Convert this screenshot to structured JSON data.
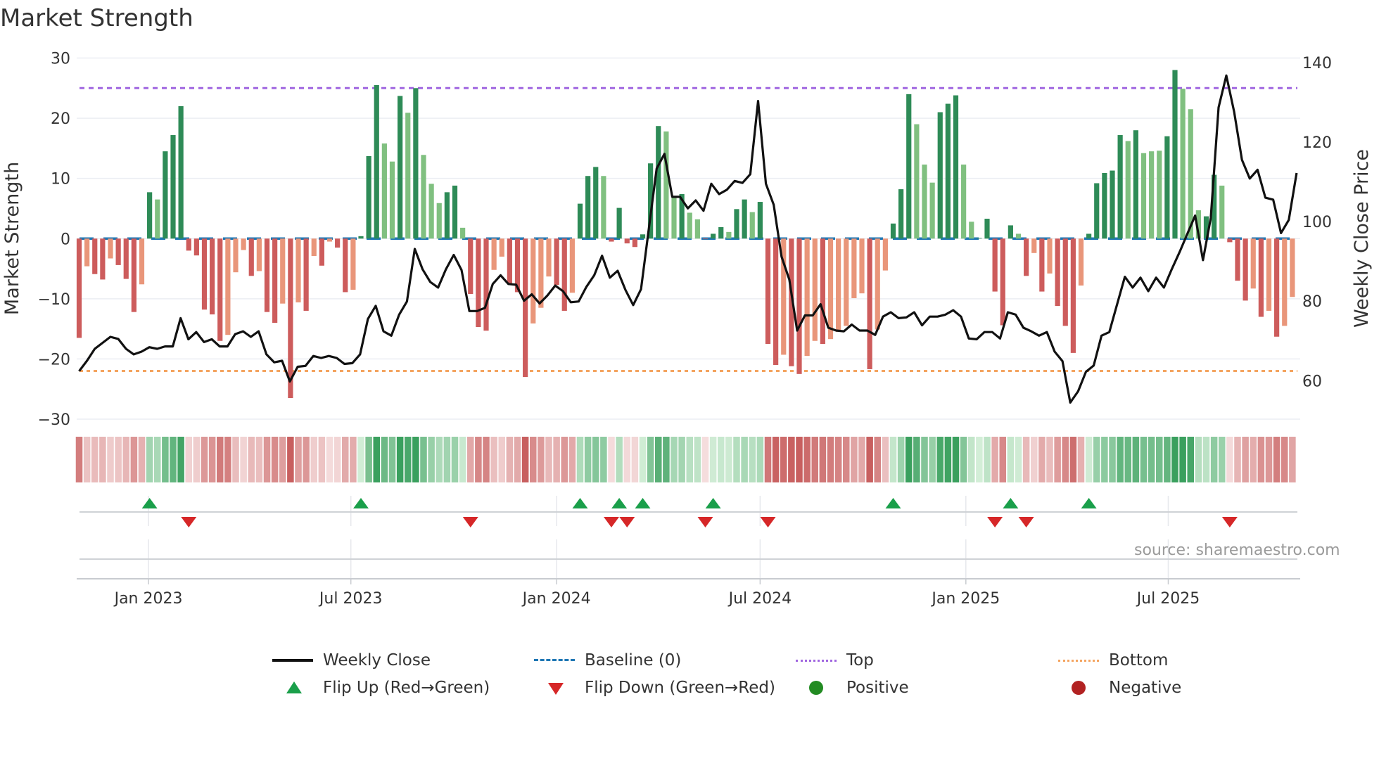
{
  "title": "Market Strength",
  "source": "source: sharemaestro.com",
  "colors": {
    "green_strong": "#2e8b57",
    "green_weak": "#80c080",
    "red_strong": "#cd5c5c",
    "red_weak": "#e9967a",
    "line": "#111111",
    "baseline": "#1f77b4",
    "top": "#a066e0",
    "bottom": "#f4a460",
    "flip_up": "#1a9f4a",
    "flip_down": "#d62728"
  },
  "legend": {
    "weekly_close": "Weekly Close",
    "baseline": "Baseline (0)",
    "top": "Top",
    "bottom": "Bottom",
    "flip_up": "Flip Up (Red→Green)",
    "flip_down": "Flip Down (Green→Red)",
    "positive": "Positive",
    "negative": "Negative"
  },
  "chart_data": {
    "type": "bar+line",
    "title": "Market Strength",
    "ylabel": "Market Strength",
    "y2label": "Weekly Close Price",
    "ylim": [
      -30,
      30
    ],
    "yticks": [
      30,
      20,
      10,
      0,
      -10,
      -20,
      -30
    ],
    "ytick_labels": [
      "30",
      "20",
      "10",
      "0",
      "−10",
      "−20",
      "−30"
    ],
    "y2lim": [
      60,
      140
    ],
    "y2ticks": [
      140,
      120,
      100,
      80,
      60
    ],
    "y2tick_labels": [
      "140",
      "120",
      "100",
      "80",
      "60"
    ],
    "start_week": "2022-10-31",
    "xticks": [
      {
        "date": "2023-01-01",
        "label": "Jan 2023"
      },
      {
        "date": "2023-07-01",
        "label": "Jul 2023"
      },
      {
        "date": "2024-01-01",
        "label": "Jan 2024"
      },
      {
        "date": "2024-07-01",
        "label": "Jul 2024"
      },
      {
        "date": "2025-01-01",
        "label": "Jan 2025"
      },
      {
        "date": "2025-07-01",
        "label": "Jul 2025"
      }
    ],
    "top_level": 25,
    "bottom_level": -22,
    "baseline": 0,
    "strength": [
      -16.5,
      -4.6,
      -5.9,
      -6.8,
      -3.3,
      -4.4,
      -6.7,
      -12.2,
      -7.6,
      7.7,
      6.5,
      14.5,
      17.2,
      22,
      -2,
      -2.8,
      -11.8,
      -12.6,
      -17,
      -16,
      -5.6,
      -1.9,
      -6.2,
      -5.4,
      -12.2,
      -14,
      -10.8,
      -26.5,
      -10.6,
      -12,
      -2.9,
      -4.5,
      -0.5,
      -1.5,
      -8.9,
      -8.5,
      0.4,
      13.7,
      25.5,
      15.8,
      12.8,
      23.7,
      20.9,
      25,
      13.9,
      9.1,
      5.9,
      7.7,
      8.8,
      1.8,
      -9.2,
      -14.7,
      -15.3,
      -5.2,
      -3,
      -7.5,
      -8.9,
      -23,
      -14.1,
      -11.5,
      -6.3,
      -7.7,
      -12,
      -9,
      5.8,
      10.4,
      11.9,
      10.4,
      -0.5,
      5.1,
      -0.8,
      -1.4,
      0.7,
      12.5,
      18.7,
      17.8,
      6.9,
      7.4,
      4.3,
      3.2,
      -0.1,
      0.8,
      1.9,
      1.1,
      4.9,
      6.5,
      4.4,
      6.1,
      -17.5,
      -21,
      -19.3,
      -21.2,
      -22.5,
      -19.5,
      -17,
      -17.5,
      -16.7,
      -15.5,
      -14.5,
      -9.9,
      -9.1,
      -21.7,
      -15.1,
      -5.3,
      2.5,
      8.2,
      24,
      19,
      12.3,
      9.3,
      21,
      22.4,
      23.8,
      12.3,
      2.8,
      0.1,
      3.3,
      -8.8,
      -14.4,
      2.2,
      0.8,
      -6.2,
      -2.4,
      -8.8,
      -5.8,
      -11.2,
      -14.5,
      -19,
      -7.8,
      0.8,
      9.2,
      10.9,
      11.3,
      17.2,
      16.2,
      18,
      14.2,
      14.5,
      14.6,
      17,
      28,
      24.9,
      21.5,
      4.7,
      3.7,
      10.6,
      8.8,
      -0.6,
      -7,
      -10.3,
      -8.3,
      -13,
      -12,
      -16.3,
      -14.5,
      -9.7
    ],
    "strong": [
      1,
      0,
      1,
      1,
      0,
      1,
      1,
      1,
      0,
      1,
      0,
      1,
      1,
      1,
      1,
      1,
      1,
      1,
      1,
      0,
      0,
      0,
      1,
      0,
      1,
      1,
      0,
      1,
      0,
      1,
      0,
      1,
      0,
      1,
      1,
      0,
      1,
      1,
      1,
      0,
      0,
      1,
      0,
      1,
      0,
      0,
      0,
      1,
      1,
      0,
      1,
      1,
      1,
      0,
      0,
      1,
      1,
      1,
      0,
      0,
      0,
      1,
      1,
      0,
      1,
      1,
      1,
      0,
      1,
      1,
      1,
      1,
      1,
      1,
      1,
      0,
      0,
      1,
      0,
      0,
      1,
      1,
      1,
      0,
      1,
      1,
      0,
      1,
      1,
      1,
      0,
      1,
      1,
      0,
      0,
      1,
      0,
      0,
      0,
      0,
      0,
      1,
      0,
      0,
      1,
      1,
      1,
      0,
      0,
      0,
      1,
      1,
      1,
      0,
      0,
      1,
      1,
      1,
      1,
      1,
      0,
      1,
      0,
      1,
      0,
      1,
      1,
      1,
      0,
      1,
      1,
      1,
      1,
      1,
      0,
      1,
      0,
      0,
      0,
      1,
      1,
      0,
      0,
      0,
      1,
      1,
      0,
      1,
      1,
      1,
      0,
      1,
      0,
      1,
      0,
      0
    ],
    "weekly_close": [
      62.4,
      65,
      68,
      69.5,
      71,
      70.5,
      68,
      66.6,
      67.3,
      68.4,
      68,
      68.6,
      68.6,
      75.7,
      70.4,
      72.2,
      69.7,
      70.4,
      68.6,
      68.6,
      71.7,
      72.4,
      71,
      72.4,
      66.6,
      64.6,
      65,
      59.8,
      63.5,
      63.7,
      66.2,
      65.7,
      66.2,
      65.7,
      64.2,
      64.4,
      66.6,
      75.5,
      78.8,
      72.4,
      71.3,
      76.6,
      79.9,
      93.1,
      88,
      84.8,
      83.4,
      88,
      91.6,
      87.8,
      77.5,
      77.5,
      78.3,
      84.3,
      86.5,
      84.3,
      84.1,
      80.1,
      81.7,
      79.4,
      81.4,
      83.9,
      82.5,
      79.7,
      79.9,
      83.6,
      86.5,
      91.4,
      85.9,
      87.6,
      82.8,
      79,
      83,
      98.2,
      113.3,
      117,
      106.2,
      106.2,
      103.3,
      105.3,
      102.7,
      109.5,
      106.9,
      108,
      110.2,
      109.7,
      111.9,
      130.3,
      109.5,
      104.2,
      91.2,
      85.4,
      72.6,
      76.4,
      76.4,
      79.2,
      73.3,
      72.6,
      72.4,
      74.1,
      72.6,
      72.6,
      71.5,
      76.1,
      77.2,
      75.7,
      75.9,
      77.2,
      73.9,
      76.1,
      76.1,
      76.6,
      77.7,
      76.1,
      70.6,
      70.4,
      72.2,
      72.2,
      70.6,
      77.2,
      76.6,
      73.3,
      72.4,
      71.3,
      72.2,
      67.3,
      64.9,
      54.5,
      57.3,
      62.2,
      63.8,
      71.3,
      72.2,
      79.2,
      86.1,
      83.4,
      85.9,
      82.5,
      85.9,
      83.4,
      88,
      92.3,
      96.9,
      101.5,
      90.3,
      100.9,
      128.7,
      136.7,
      127.6,
      115.5,
      110.8,
      113,
      106,
      105.5,
      97.1,
      100.4,
      112.2
    ],
    "flip_up_weeks": [
      9,
      36,
      64,
      69,
      72,
      81,
      104,
      119,
      129
    ],
    "flip_down_weeks": [
      14,
      50,
      68,
      70,
      80,
      88,
      117,
      121,
      147
    ],
    "legend_position": "bottom"
  }
}
